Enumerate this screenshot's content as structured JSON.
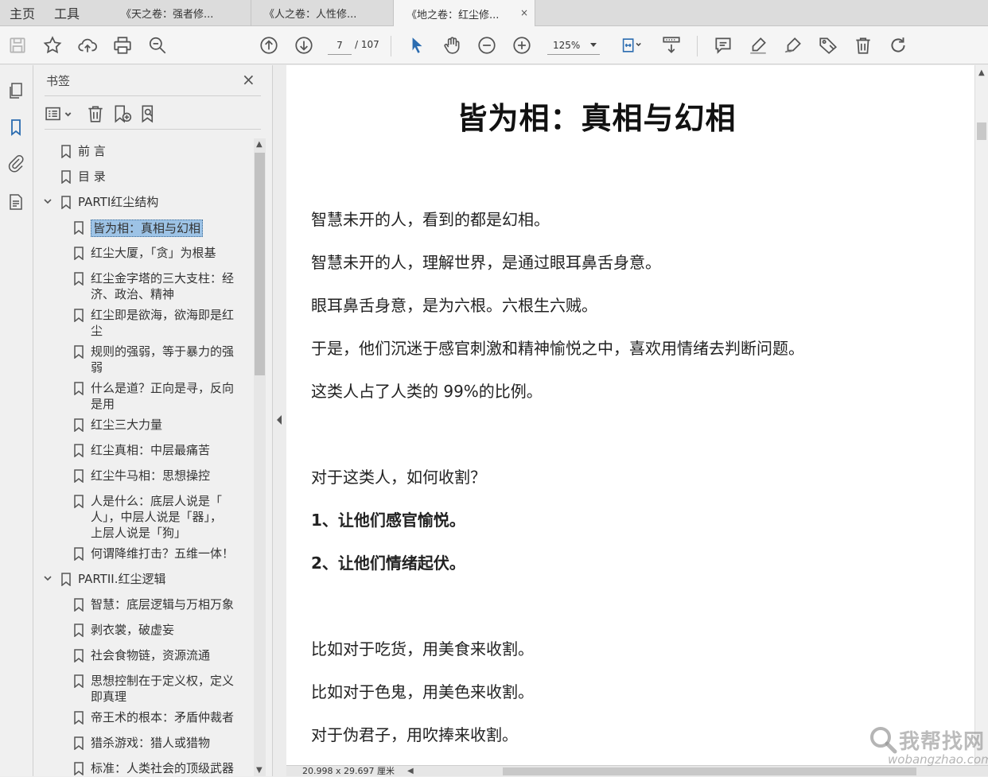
{
  "menu": {
    "home": "主页",
    "tools": "工具"
  },
  "tabs": [
    {
      "label": "《天之卷：强者修..."
    },
    {
      "label": "《人之卷：人性修..."
    },
    {
      "label": "《地之卷：红尘修...",
      "active": true,
      "close": "×"
    }
  ],
  "toolbar": {
    "page_current": "7",
    "page_total": "/ 107",
    "zoom": "125%"
  },
  "panel": {
    "title": "书签",
    "close": "×",
    "bookmarks": [
      {
        "label": "前 言"
      },
      {
        "label": "目 录"
      },
      {
        "label": "PARTI红尘结构",
        "expanded": true
      },
      {
        "label": "皆为相：真相与幻相",
        "selected": true
      },
      {
        "label": "红尘大厦，「贪」为根基"
      },
      {
        "label": "红尘金字塔的三大支柱：经",
        "label2": "济、政治、精神"
      },
      {
        "label": "红尘即是欲海，欲海即是红",
        "label2": "尘"
      },
      {
        "label": "规则的强弱，等于暴力的强",
        "label2": "弱"
      },
      {
        "label": "什么是道？正向是寻，反向",
        "label2": "是用"
      },
      {
        "label": "红尘三大力量"
      },
      {
        "label": "红尘真相：中层最痛苦"
      },
      {
        "label": "红尘牛马相：思想操控"
      },
      {
        "label": "人是什么：底层人说是「",
        "label2": "人」，中层人说是「器」，",
        "label3": "上层人说是「狗」"
      },
      {
        "label": "何谓降维打击？五维一体！"
      },
      {
        "label": "PARTII.红尘逻辑",
        "expanded": true
      },
      {
        "label": "智慧：底层逻辑与万相万象"
      },
      {
        "label": "剥衣裳，破虚妄"
      },
      {
        "label": "社会食物链，资源流通"
      },
      {
        "label": "思想控制在于定义权，定义",
        "label2": "即真理"
      },
      {
        "label": "帝王术的根本：矛盾仲裁者"
      },
      {
        "label": "猎杀游戏：猎人或猎物"
      },
      {
        "label": "标准：人类社会的顶级武器"
      }
    ]
  },
  "document": {
    "title": "皆为相：真相与幻相",
    "paragraphs": [
      "智慧未开的人，看到的都是幻相。",
      "智慧未开的人，理解世界，是通过眼耳鼻舌身意。",
      "眼耳鼻舌身意，是为六根。六根生六贼。",
      "于是，他们沉迷于感官刺激和精神愉悦之中，喜欢用情绪去判断问题。",
      "这类人占了人类的 99%的比例。",
      "对于这类人，如何收割？",
      "1、让他们感官愉悦。",
      "2、让他们情绪起伏。",
      "比如对于吃货，用美食来收割。",
      "比如对于色鬼，用美色来收割。",
      "对于伪君子，用吹捧来收割。"
    ]
  },
  "status": {
    "page_size": "20.998 x 29.697 厘米"
  },
  "watermark": {
    "text": "我帮找网",
    "url": "wobangzhao.com"
  },
  "colors": {
    "selection": "#9dc3e6",
    "accent_blue": "#2b6cb0"
  }
}
